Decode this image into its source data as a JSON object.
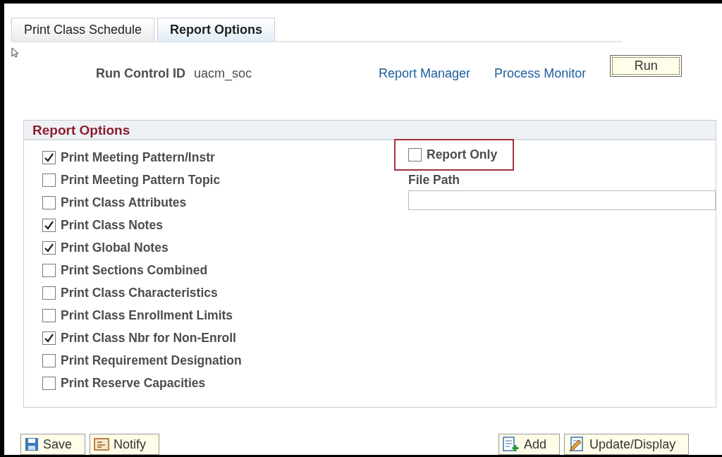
{
  "tabs": [
    {
      "label": "Print Class Schedule",
      "selected": false
    },
    {
      "label": "Report Options",
      "selected": true
    }
  ],
  "run_control": {
    "label": "Run Control ID",
    "value": "uacm_soc"
  },
  "links": [
    "Report Manager",
    "Process Monitor"
  ],
  "run_button": "Run",
  "section": {
    "title": "Report Options",
    "options": [
      {
        "label": "Print Meeting Pattern/Instr",
        "checked": true
      },
      {
        "label": "Print Meeting Pattern Topic",
        "checked": false
      },
      {
        "label": "Print Class Attributes",
        "checked": false
      },
      {
        "label": "Print Class Notes",
        "checked": true
      },
      {
        "label": "Print Global Notes",
        "checked": true
      },
      {
        "label": "Print Sections Combined",
        "checked": false
      },
      {
        "label": "Print Class Characteristics",
        "checked": false
      },
      {
        "label": "Print Class Enrollment Limits",
        "checked": false
      },
      {
        "label": "Print Class Nbr for Non-Enroll",
        "checked": true
      },
      {
        "label": "Print Requirement Designation",
        "checked": false
      },
      {
        "label": "Print Reserve Capacities",
        "checked": false
      }
    ],
    "report_only": {
      "label": "Report Only",
      "checked": false
    },
    "file_path": {
      "label": "File Path"
    }
  },
  "bottom_buttons": [
    {
      "label": "Save",
      "kind": "save"
    },
    {
      "label": "Notify",
      "kind": "notify"
    },
    {
      "label": "Add",
      "kind": "add"
    },
    {
      "label": "Update/Display",
      "kind": "update"
    }
  ]
}
